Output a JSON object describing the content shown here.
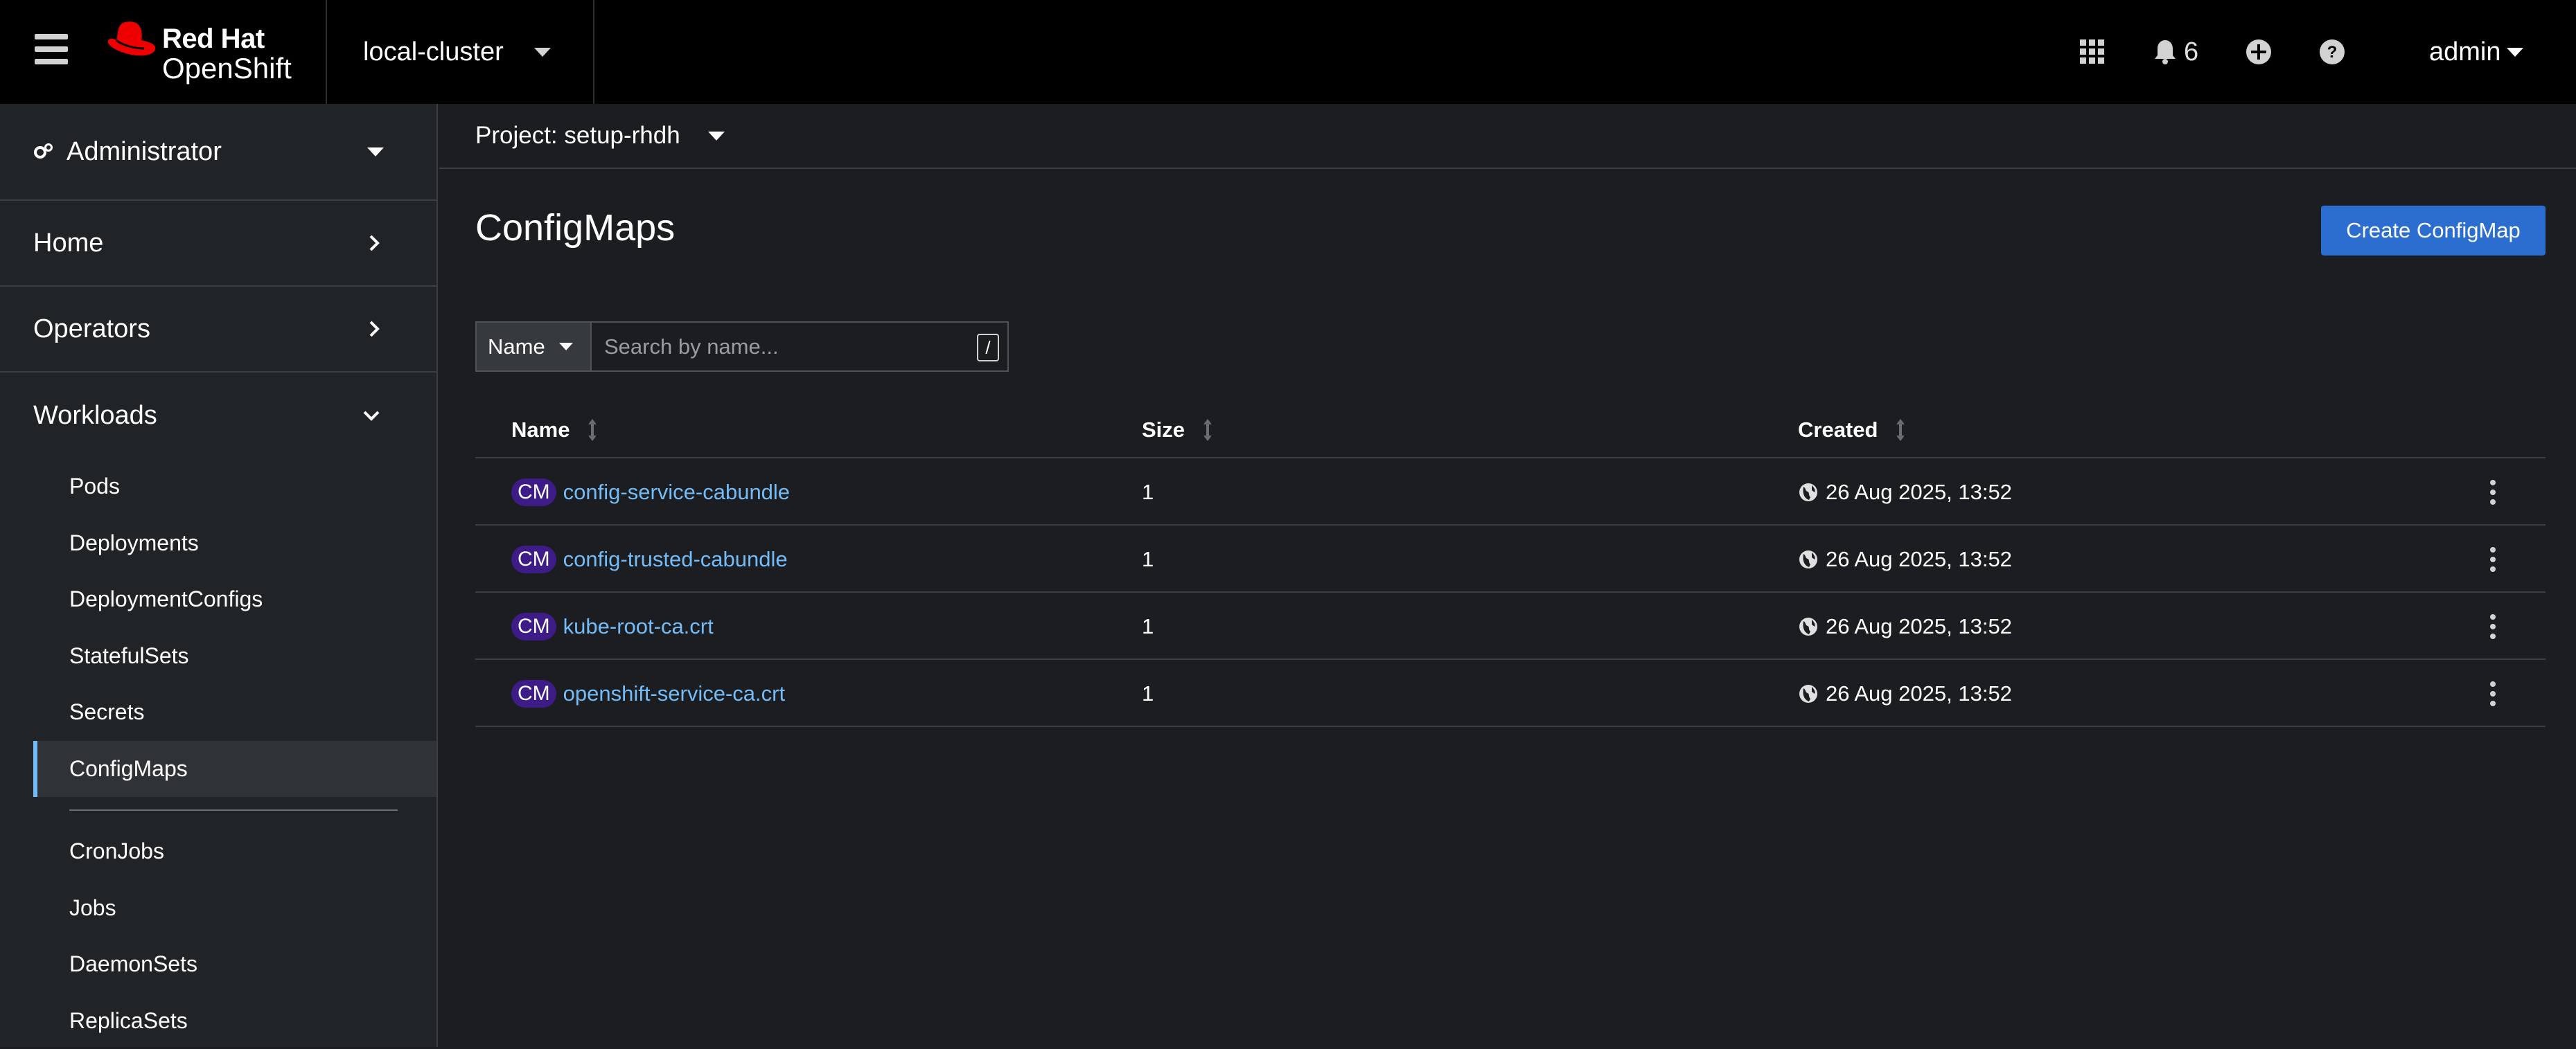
{
  "masthead": {
    "brand_line1": "Red Hat",
    "brand_line2": "OpenShift",
    "cluster": "local-cluster",
    "notifications_count": "6",
    "user": "admin",
    "icons": [
      "menu-icon",
      "apps-grid-icon",
      "bell-icon",
      "plus-circle-icon",
      "help-icon"
    ]
  },
  "sidebar": {
    "perspective": "Administrator",
    "sections": [
      {
        "label": "Home",
        "state": "collapsed"
      },
      {
        "label": "Operators",
        "state": "collapsed"
      },
      {
        "label": "Workloads",
        "state": "expanded"
      }
    ],
    "workloads_items": [
      "Pods",
      "Deployments",
      "DeploymentConfigs",
      "StatefulSets",
      "Secrets",
      "ConfigMaps"
    ],
    "workloads_items_after": [
      "CronJobs",
      "Jobs",
      "DaemonSets",
      "ReplicaSets"
    ],
    "active_item": "ConfigMaps"
  },
  "main": {
    "project_label": "Project: setup-rhdh",
    "title": "ConfigMaps",
    "create_button": "Create ConfigMap",
    "filter": {
      "select_label": "Name",
      "placeholder": "Search by name...",
      "shortcut": "/"
    },
    "columns": [
      "Name",
      "Size",
      "Created"
    ],
    "badge": "CM",
    "rows": [
      {
        "name": "config-service-cabundle",
        "size": "1",
        "created": "26 Aug 2025, 13:52"
      },
      {
        "name": "config-trusted-cabundle",
        "size": "1",
        "created": "26 Aug 2025, 13:52"
      },
      {
        "name": "kube-root-ca.crt",
        "size": "1",
        "created": "26 Aug 2025, 13:52"
      },
      {
        "name": "openshift-service-ca.crt",
        "size": "1",
        "created": "26 Aug 2025, 13:52"
      }
    ]
  },
  "colors": {
    "masthead_bg": "#000000",
    "sidebar_bg": "#212427",
    "page_bg": "#1b1d21",
    "link": "#73bcf7",
    "primary_button": "#2b6ecf",
    "badge_bg": "#3e1c87",
    "active_indicator": "#73bcf7",
    "brand_red": "#ee0000"
  }
}
